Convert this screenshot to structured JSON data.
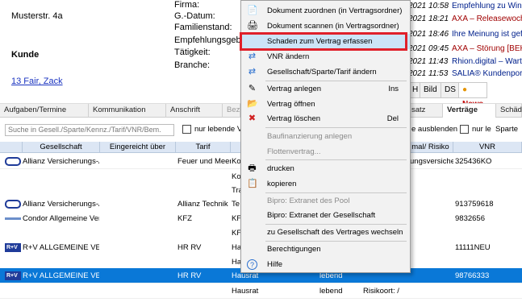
{
  "customer": {
    "address": "Musterstr. 4a",
    "section_label": "Kunde",
    "contact_link": "13 Fair, Zack",
    "fields": [
      "Firma:",
      "G.-Datum:",
      "Familienstand:",
      "Empfehlungsgeber:",
      "Tätigkeit:",
      "Branche:"
    ]
  },
  "news": [
    {
      "date": "2021 10:58",
      "text": "Empfehlung zu Win"
    },
    {
      "date": "2021 18:21",
      "text": "AXA – Releasewoche"
    },
    {
      "date": "2021 18:46",
      "text": "Ihre Meinung ist gef"
    },
    {
      "date": "2021 09:45",
      "text": "AXA – Störung [BEHO"
    },
    {
      "date": "2021 11:43",
      "text": "Rhion.digital – Wart"
    },
    {
      "date": "2021 11:53",
      "text": "SALIA® Kundenport"
    }
  ],
  "right_tabs": [
    "H",
    "Bild",
    "DS",
    "News"
  ],
  "tabs": [
    "Aufgaben/Termine",
    "Kommunikation",
    "Anschrift",
    "Bezie",
    "satz",
    "Verträge",
    "Schäde"
  ],
  "filter": {
    "search_placeholder": "Suche in  Gesell./Sparte/Kennz./Tarif/VNR/Bem.",
    "cb1_label": "nur lebende Ve",
    "cb2_label": "e ausblenden",
    "cb3_label": "nur le",
    "cb3_extra": "Sparte"
  },
  "columns": [
    "Gesellschaft",
    "Eingereicht über",
    "Tarif",
    "",
    "",
    "mal/ Risiko",
    "VNR"
  ],
  "rows": [
    {
      "logo": "allianz",
      "company": "Allianz Versicherungs-A",
      "tarif": "Feuer und Meer",
      "sparte": "Ko",
      "risk": "ungsversiche",
      "vnr": "325436KO"
    },
    {
      "logo": "",
      "company": "",
      "tarif": "",
      "sparte": "Ko",
      "risk": "",
      "vnr": ""
    },
    {
      "logo": "",
      "company": "",
      "tarif": "",
      "sparte": "Tra",
      "risk": "",
      "vnr": ""
    },
    {
      "logo": "allianz",
      "company": "Allianz Versicherungs-A",
      "tarif": "Allianz Technik",
      "sparte": "Te",
      "risk": "",
      "vnr": "913759618"
    },
    {
      "logo": "condor",
      "company": "Condor Allgemeine Ver",
      "tarif": "KFZ",
      "sparte": "KF",
      "risk": "",
      "vnr": "9832656"
    },
    {
      "logo": "",
      "company": "",
      "tarif": "",
      "sparte": "KF",
      "risk": "",
      "vnr": ""
    },
    {
      "logo": "rv",
      "company": "R+V ALLGEMEINE VERS",
      "tarif": "HR RV",
      "sparte": "Ha",
      "risk": "",
      "vnr": "11111NEU"
    },
    {
      "logo": "",
      "company": "",
      "tarif": "",
      "sparte": "Ha",
      "risk": "",
      "vnr": ""
    },
    {
      "logo": "rv",
      "company": "R+V ALLGEMEINE VERS",
      "tarif": "HR RV",
      "sparte": "Hausrat",
      "status": "lebend",
      "risk": "",
      "vnr": "98766333"
    },
    {
      "logo": "",
      "company": "",
      "tarif": "",
      "sparte": "Hausrat",
      "status": "lebend",
      "risk": "Risikoort:  /",
      "vnr": ""
    }
  ],
  "menu": [
    {
      "icon": "document-assign-icon",
      "glyph": "📄",
      "label": "Dokument zuordnen (in Vertragsordner)",
      "sc": "",
      "dis": false
    },
    {
      "icon": "scanner-icon",
      "glyph": "🖨",
      "label": "Dokument scannen (in Vertragsordner)",
      "sc": "",
      "dis": false
    },
    {
      "icon": "",
      "glyph": "",
      "label": "Schaden zum Vertrag erfassen",
      "sc": "",
      "dis": false,
      "hl": true
    },
    {
      "icon": "change-arrows-icon",
      "glyph": "⇄",
      "label": "VNR ändern",
      "sc": "",
      "dis": false
    },
    {
      "icon": "change-arrows-icon",
      "glyph": "⇄",
      "label": "Gesellschaft/Sparte/Tarif ändern",
      "sc": "",
      "dis": false
    },
    {
      "sep": true
    },
    {
      "icon": "new-contract-icon",
      "glyph": "✎",
      "label": "Vertrag anlegen",
      "sc": "Ins",
      "dis": false
    },
    {
      "icon": "folder-open-icon",
      "glyph": "📂",
      "label": "Vertrag öffnen",
      "sc": "",
      "dis": false
    },
    {
      "icon": "delete-contract-icon",
      "glyph": "✖",
      "label": "Vertrag löschen",
      "sc": "Del",
      "dis": false
    },
    {
      "sep": true
    },
    {
      "icon": "",
      "glyph": "",
      "label": "Baufinanzierung anlegen",
      "sc": "",
      "dis": true
    },
    {
      "icon": "",
      "glyph": "",
      "label": "Flottenvertrag...",
      "sc": "",
      "dis": true
    },
    {
      "sep": true
    },
    {
      "icon": "print-icon",
      "glyph": "🖶",
      "label": "drucken",
      "sc": "",
      "dis": false
    },
    {
      "icon": "copy-icon",
      "glyph": "📋",
      "label": "kopieren",
      "sc": "",
      "dis": false
    },
    {
      "sep": true
    },
    {
      "icon": "",
      "glyph": "",
      "label": "Bipro: Extranet des Pool",
      "sc": "",
      "dis": true
    },
    {
      "icon": "",
      "glyph": "",
      "label": "Bipro: Extranet der Gesellschaft",
      "sc": "",
      "dis": false
    },
    {
      "sep": true
    },
    {
      "icon": "",
      "glyph": "",
      "label": "zu Gesellschaft des Vertrages wechseln",
      "sc": "",
      "dis": false
    },
    {
      "sep": true
    },
    {
      "icon": "",
      "glyph": "",
      "label": "Berechtigungen",
      "sc": "",
      "dis": false
    },
    {
      "icon": "help-icon",
      "glyph": "?",
      "label": "Hilfe",
      "sc": "",
      "dis": false
    }
  ]
}
